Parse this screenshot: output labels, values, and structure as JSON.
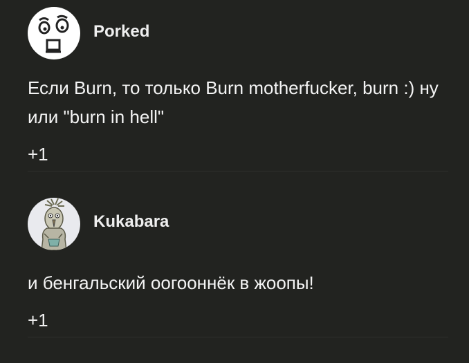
{
  "comments": [
    {
      "author": "Porked",
      "avatar_icon": "cartoon-face-icon",
      "text": "Если Burn, то только Burn motherfucker, burn :) ну или \"burn in hell\"",
      "votes": "+1"
    },
    {
      "author": "Kukabara",
      "avatar_icon": "bird-drawing-icon",
      "text": "и бенгальский оогооннёк в жоопы!",
      "votes": "+1"
    }
  ],
  "colors": {
    "background": "#222320",
    "text": "#f2f2f2",
    "divider": "#2f302d"
  }
}
